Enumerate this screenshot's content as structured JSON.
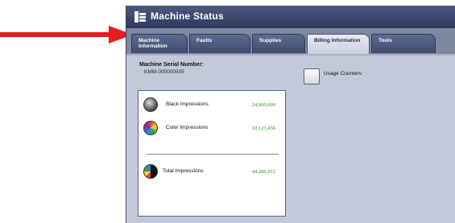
{
  "window": {
    "title": "Machine Status"
  },
  "tabs": [
    {
      "label_line1": "Machine",
      "label_line2": "Information"
    },
    {
      "label_line1": "Faults",
      "label_line2": ""
    },
    {
      "label_line1": "Supplies",
      "label_line2": ""
    },
    {
      "label_line1": "Billing Information",
      "label_line2": ""
    },
    {
      "label_line1": "Tools",
      "label_line2": ""
    }
  ],
  "active_tab": "Billing Information",
  "serial": {
    "label": "Machine Serial Number:",
    "value": "KMM-000000505"
  },
  "usage_counters": {
    "label": "Usage Counters"
  },
  "counters": {
    "black": {
      "label": "Black Impressions",
      "value": "24,000,000"
    },
    "color": {
      "label": "Color Impressions",
      "value": "10,123,456"
    },
    "total": {
      "label": "Total Impressions",
      "value": "44,286,912"
    }
  },
  "colors": {
    "arrow": "#e81c1c",
    "value_text": "#2e8b2e",
    "title_bar": "#2e3a5c"
  }
}
